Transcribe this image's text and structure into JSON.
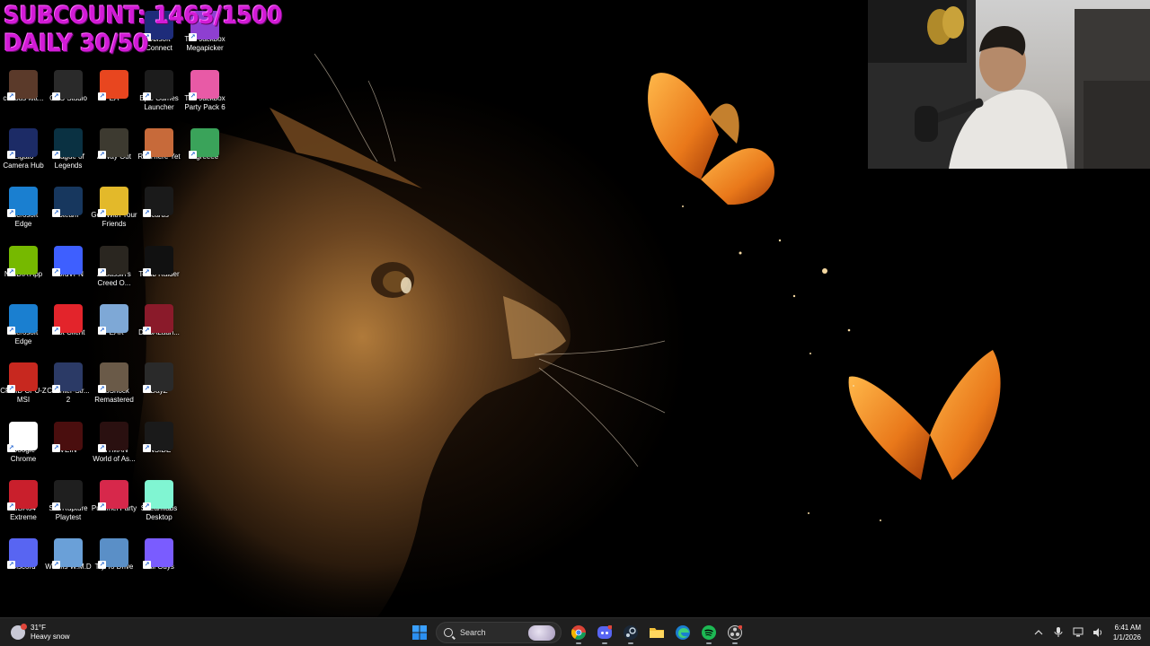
{
  "overlay": {
    "line1": "SUBCOUNT: 1463/1500",
    "line2": "DAILY 30/50"
  },
  "desktop_icons": [
    {
      "label": "Elgato Camera Hub",
      "icon": "elgato-camera-hub-icon",
      "bg": "#1c2b66"
    },
    {
      "label": "curious-kitt...",
      "icon": "file-icon",
      "bg": "#5b3a2a"
    },
    {
      "label": "OBS Studio",
      "icon": "obs-icon",
      "bg": "#2a2a2a"
    },
    {
      "label": "EA",
      "icon": "ea-icon",
      "bg": "#e8461f"
    },
    {
      "label": "Epic Games Launcher",
      "icon": "epic-games-icon",
      "bg": "#1c1c1c"
    },
    {
      "label": "The Jackbox Party Pack 6",
      "icon": "jackbox-icon",
      "bg": "#e85aa6"
    },
    {
      "label": "Ubisoft Connect",
      "icon": "ubisoft-icon",
      "bg": "#1e2c7a"
    },
    {
      "label": "The Jackbox Megapicker",
      "icon": "jackbox-megapicker-icon",
      "bg": "#8e3fd1"
    },
    {
      "label": "League of Legends",
      "icon": "league-of-legends-icon",
      "bg": "#0a3142"
    },
    {
      "label": "A Way Out",
      "icon": "a-way-out-icon",
      "bg": "#3d3a30"
    },
    {
      "label": "RV There Yet",
      "icon": "rv-there-yet-icon",
      "bg": "#c76a3a"
    },
    {
      "label": "Agreeee",
      "icon": "agreeee-icon",
      "bg": "#3aa35a"
    },
    {
      "label": "Microsoft Edge",
      "icon": "edge-icon",
      "bg": "#1a7fd0"
    },
    {
      "label": "Steam",
      "icon": "steam-icon",
      "bg": "#17375e"
    },
    {
      "label": "Golf With Your Friends",
      "icon": "golf-with-your-friends-icon",
      "bg": "#e3b92a"
    },
    {
      "label": "Icarus",
      "icon": "icarus-icon",
      "bg": "#1a1a1a"
    },
    {
      "label": "NVIDIA App",
      "icon": "nvidia-icon",
      "bg": "#76b900"
    },
    {
      "label": "NordVPN",
      "icon": "nordvpn-icon",
      "bg": "#3e5fff"
    },
    {
      "label": "Assassin's Creed O...",
      "icon": "assassins-creed-icon",
      "bg": "#2a2620"
    },
    {
      "label": "Tomb Raider",
      "icon": "tomb-raider-icon",
      "bg": "#111111"
    },
    {
      "label": "Microsoft Edge",
      "icon": "edge-icon",
      "bg": "#1a7fd0"
    },
    {
      "label": "Riot Client",
      "icon": "riot-client-icon",
      "bg": "#e3242b"
    },
    {
      "label": "PEAK",
      "icon": "peak-icon",
      "bg": "#7ea8d6"
    },
    {
      "label": "DZSALaun...",
      "icon": "dzsa-launcher-icon",
      "bg": "#8a1a2a"
    },
    {
      "label": "CPUID CPU-Z MSI",
      "icon": "cpuz-icon",
      "bg": "#c7281f"
    },
    {
      "label": "Counter-Str... 2",
      "icon": "counter-strike-icon",
      "bg": "#2b3a66"
    },
    {
      "label": "BioShock Remastered",
      "icon": "bioshock-icon",
      "bg": "#6a5a48"
    },
    {
      "label": "DayZ",
      "icon": "dayz-icon",
      "bg": "#2a2a2a"
    },
    {
      "label": "Google Chrome",
      "icon": "chrome-icon",
      "bg": "#ffffff"
    },
    {
      "label": "VEIN",
      "icon": "vein-icon",
      "bg": "#4a0e0e"
    },
    {
      "label": "HITMAN World of As...",
      "icon": "hitman-icon",
      "bg": "#2a1010"
    },
    {
      "label": "INSIDE",
      "icon": "inside-icon",
      "bg": "#1a1a1a"
    },
    {
      "label": "AIDA64 Extreme",
      "icon": "aida64-icon",
      "bg": "#c91f2c"
    },
    {
      "label": "StarRupture Playtest",
      "icon": "starrupture-icon",
      "bg": "#1f1f1f"
    },
    {
      "label": "Pummel Party",
      "icon": "pummel-party-icon",
      "bg": "#d7284b"
    },
    {
      "label": "Streamlabs Desktop",
      "icon": "streamlabs-icon",
      "bg": "#80f5d2"
    },
    {
      "label": "Discord",
      "icon": "discord-icon",
      "bg": "#5865f2"
    },
    {
      "label": "Worms W.M.D",
      "icon": "worms-icon",
      "bg": "#6aa0d8"
    },
    {
      "label": "Try To Drive",
      "icon": "try-to-drive-icon",
      "bg": "#5a8fc7"
    },
    {
      "label": "Fall Guys",
      "icon": "fall-guys-icon",
      "bg": "#7a5cff"
    }
  ],
  "taskbar": {
    "weather_temp": "31°F",
    "weather_desc": "Heavy snow",
    "search_label": "Search",
    "pinned": [
      "chrome-icon",
      "discord-icon",
      "steam-icon",
      "file-explorer-icon",
      "edge-icon",
      "spotify-icon",
      "obs-icon"
    ],
    "time": "6:41 AM",
    "date": "1/1/2026"
  },
  "colors": {
    "overlay_text": "#d21bd6",
    "taskbar_bg": "#1f1f1f",
    "accent_blue": "#1a7fd0"
  }
}
